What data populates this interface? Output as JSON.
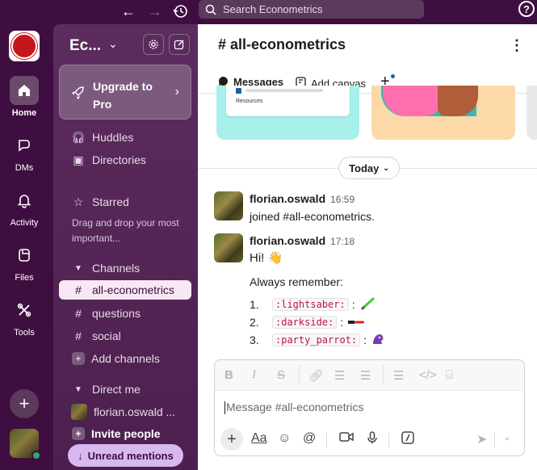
{
  "search": {
    "placeholder": "Search Econometrics"
  },
  "rail": {
    "items": [
      {
        "label": "Home"
      },
      {
        "label": "DMs"
      },
      {
        "label": "Activity"
      },
      {
        "label": "Files"
      },
      {
        "label": "Tools"
      }
    ]
  },
  "workspace": {
    "name": "Ec..."
  },
  "upgrade": {
    "label": "Upgrade to Pro"
  },
  "sidebar": {
    "huddles": "Huddles",
    "directories": "Directories",
    "starred": "Starred",
    "starred_hint": "Drag and drop your most important...",
    "channels_header": "Channels",
    "channels": [
      {
        "name": "all-econometrics",
        "active": true
      },
      {
        "name": "questions"
      },
      {
        "name": "social"
      }
    ],
    "add_channels": "Add channels",
    "dm_header": "Direct me",
    "dm_user": "florian.oswald ...",
    "invite": "Invite people",
    "unread": "Unread mentions"
  },
  "channel": {
    "title": "# all-econometrics",
    "tabs": [
      {
        "label": "Messages"
      },
      {
        "label": "Add canvas"
      }
    ],
    "canvas_card_label": "Resources",
    "today": "Today"
  },
  "messages": [
    {
      "user": "florian.oswald",
      "time": "16:59",
      "text": "joined #all-econometrics."
    },
    {
      "user": "florian.oswald",
      "time": "17:18",
      "text": "Hi! 👋",
      "line2": "Always remember:"
    }
  ],
  "list": [
    {
      "num": "1.",
      "code": ":lightsaber:",
      "colon": ":"
    },
    {
      "num": "2.",
      "code": ":darkside:",
      "colon": ":"
    },
    {
      "num": "3.",
      "code": ":party_parrot:",
      "colon": ":"
    }
  ],
  "composer": {
    "placeholder": "Message #all-econometrics"
  },
  "colors": {
    "aubergine": "#3f0e40",
    "sidebar": "#5b2c5d",
    "active_item": "#f7e8f4",
    "presence": "#2bac76"
  }
}
